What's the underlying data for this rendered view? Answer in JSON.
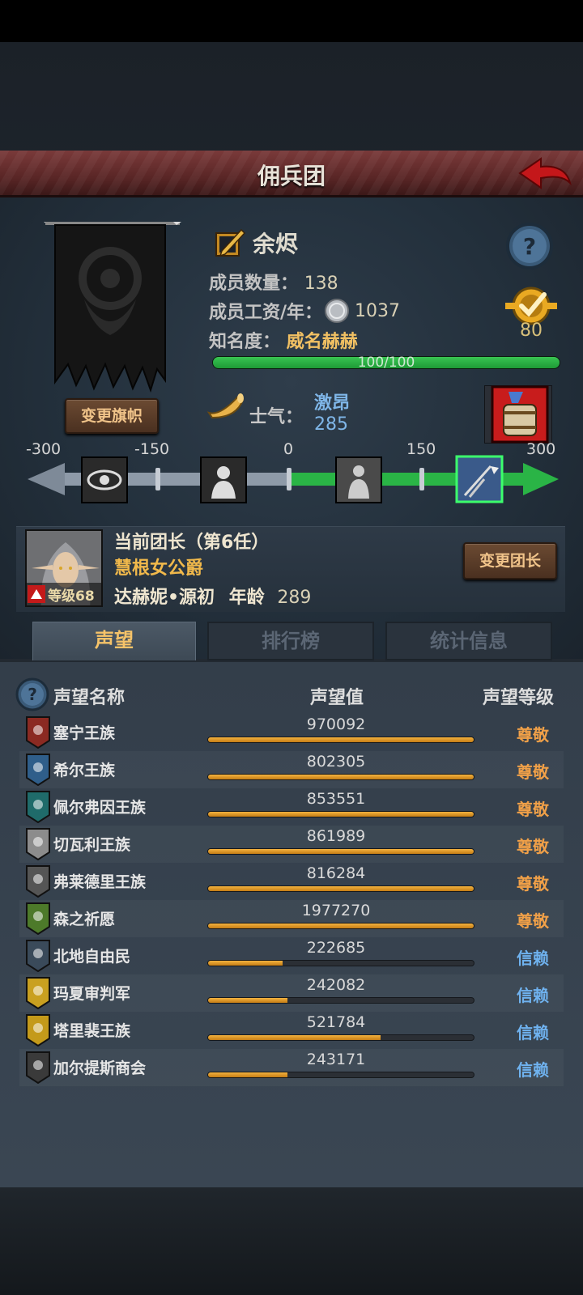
{
  "title": "佣兵团",
  "guild": {
    "name": "余烬",
    "members_label": "成员数量：",
    "members_value": "138",
    "wage_label": "成员工资/年：",
    "wage_value": "1037",
    "fame_label": "知名度：",
    "fame_value": "威名赫赫",
    "fame_progress": "100/100",
    "fame_fraction": 1.0,
    "medal_value": "80",
    "change_flag_button": "变更旗帜"
  },
  "morale": {
    "label": "士气：",
    "state": "激昂",
    "value": "285",
    "scale_labels": [
      "-300",
      "-150",
      "0",
      "150",
      "300"
    ],
    "current_fraction": 0.975
  },
  "leader": {
    "title": "当前团长（第6任）",
    "rank": "慧根女公爵",
    "name": "达赫妮•源初",
    "age_label": "年龄",
    "age_value": "289",
    "level_text": "等级68",
    "change_button": "变更团长"
  },
  "tabs": [
    {
      "label": "声望",
      "active": true
    },
    {
      "label": "排行榜",
      "active": false
    },
    {
      "label": "统计信息",
      "active": false
    }
  ],
  "reputation": {
    "col_name": "声望名称",
    "col_value": "声望值",
    "col_level": "声望等级",
    "rows": [
      {
        "name": "塞宁王族",
        "value": "970092",
        "fill": 1.0,
        "level": "尊敬",
        "level_color": "#f0a048",
        "emblem_color": "#8b2a22"
      },
      {
        "name": "希尔王族",
        "value": "802305",
        "fill": 1.0,
        "level": "尊敬",
        "level_color": "#f0a048",
        "emblem_color": "#2f5e8a"
      },
      {
        "name": "佩尔弗因王族",
        "value": "853551",
        "fill": 1.0,
        "level": "尊敬",
        "level_color": "#f0a048",
        "emblem_color": "#1f6b6a"
      },
      {
        "name": "切瓦利王族",
        "value": "861989",
        "fill": 1.0,
        "level": "尊敬",
        "level_color": "#f0a048",
        "emblem_color": "#8c8c8c"
      },
      {
        "name": "弗莱德里王族",
        "value": "816284",
        "fill": 1.0,
        "level": "尊敬",
        "level_color": "#f0a048",
        "emblem_color": "#555555"
      },
      {
        "name": "森之祈愿",
        "value": "1977270",
        "fill": 1.0,
        "level": "尊敬",
        "level_color": "#f0a048",
        "emblem_color": "#4d7a2a"
      },
      {
        "name": "北地自由民",
        "value": "222685",
        "fill": 0.28,
        "level": "信赖",
        "level_color": "#6fb2ef",
        "emblem_color": "#3a4a5a"
      },
      {
        "name": "玛夏审判军",
        "value": "242082",
        "fill": 0.3,
        "level": "信赖",
        "level_color": "#6fb2ef",
        "emblem_color": "#c9a020"
      },
      {
        "name": "塔里裴王族",
        "value": "521784",
        "fill": 0.65,
        "level": "信赖",
        "level_color": "#6fb2ef",
        "emblem_color": "#c49a1a"
      },
      {
        "name": "加尔提斯商会",
        "value": "243171",
        "fill": 0.3,
        "level": "信赖",
        "level_color": "#6fb2ef",
        "emblem_color": "#3a3a3a"
      }
    ]
  }
}
